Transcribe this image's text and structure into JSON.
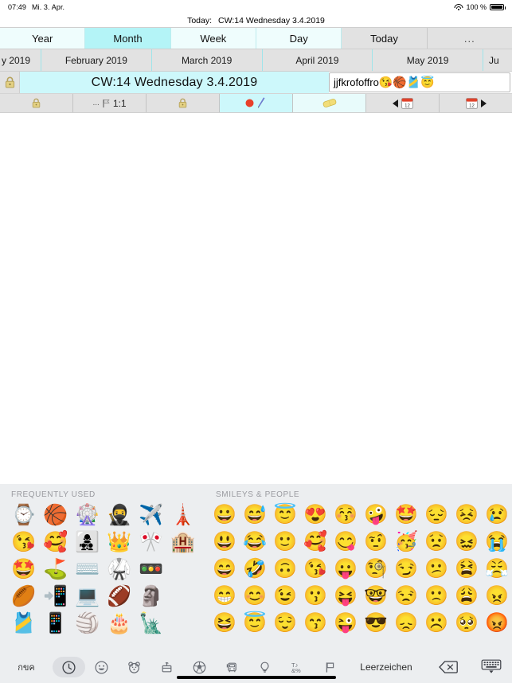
{
  "status_bar": {
    "time": "07:49",
    "date": "Mi. 3. Apr.",
    "wifi_icon": "wifi-icon",
    "battery_percent": "100 %",
    "battery_icon": "battery-full-icon"
  },
  "today_line": {
    "label": "Today:",
    "value": "CW:14 Wednesday 3.4.2019"
  },
  "view_tabs": [
    {
      "label": "Year",
      "selected": false,
      "style": "cyan"
    },
    {
      "label": "Month",
      "selected": true,
      "style": "cyan"
    },
    {
      "label": "Week",
      "selected": false,
      "style": "cyan"
    },
    {
      "label": "Day",
      "selected": false,
      "style": "cyan"
    },
    {
      "label": "Today",
      "selected": false,
      "style": "grey"
    },
    {
      "label": "...",
      "selected": false,
      "style": "grey"
    }
  ],
  "month_row": [
    {
      "label": "y 2019",
      "clipped": true
    },
    {
      "label": "February 2019",
      "clipped": false
    },
    {
      "label": "March 2019",
      "clipped": false
    },
    {
      "label": "April 2019",
      "clipped": false
    },
    {
      "label": "May 2019",
      "clipped": false
    },
    {
      "label": "Ju",
      "clipped": true
    }
  ],
  "cw_row": {
    "lock_icon": "lock-icon",
    "title": "CW:14 Wednesday 3.4.2019",
    "input_text": "jjfkrofoffro",
    "input_emojis": "😘🏀🎽😇"
  },
  "toolbar": [
    {
      "name": "lock-left",
      "icon": "🔒",
      "label": "",
      "state": "normal"
    },
    {
      "name": "zoom-ratio",
      "icon": "🏳",
      "label": "1:1",
      "prefix": "...",
      "state": "normal"
    },
    {
      "name": "lock-right",
      "icon": "🔒",
      "label": "",
      "state": "normal"
    },
    {
      "name": "record-pen",
      "icon": "🔴✒️",
      "label": "",
      "state": "highlighted"
    },
    {
      "name": "eraser",
      "icon": "🧽",
      "label": "",
      "state": "highlighted-light"
    },
    {
      "name": "prev-calendar",
      "icon": "◀📅",
      "label": "",
      "state": "normal"
    },
    {
      "name": "next-calendar",
      "icon": "📅▶",
      "label": "",
      "state": "normal"
    }
  ],
  "keyboard": {
    "sections": [
      {
        "title": "FREQUENTLY USED",
        "emojis": [
          "⌚",
          "😘",
          "🤩",
          "🏉",
          "🎽",
          "🏀",
          "🥰",
          "⛳",
          "📲",
          "📱",
          "🎡",
          "👩‍👧‍👦",
          "⌨️",
          "💻",
          "🏐",
          "🥷",
          "👑",
          "🥋",
          "🏈",
          "🎂",
          "✈️",
          "🎌",
          "🚥",
          "🗿",
          "🗽",
          "🗼",
          "🏨",
          "",
          "",
          ""
        ]
      },
      {
        "title": "SMILEYS & PEOPLE",
        "emojis": [
          "😀",
          "😃",
          "😄",
          "😁",
          "😆",
          "😅",
          "😂",
          "🤣",
          "😊",
          "😇",
          "😇",
          "🙂",
          "🙃",
          "😉",
          "😌",
          "😍",
          "🥰",
          "😘",
          "😗",
          "😙",
          "😚",
          "😋",
          "😛",
          "😝",
          "😜",
          "🤪",
          "🤨",
          "🧐",
          "🤓",
          "😎",
          "🤩",
          "🥳",
          "😏",
          "😒",
          "😞",
          "😔",
          "😟",
          "😕",
          "🙁",
          "☹️",
          "😣",
          "😖",
          "😫",
          "😩",
          "🥺",
          "😢",
          "😭",
          "😤",
          "😠",
          "😡"
        ]
      }
    ],
    "bottom_bar": {
      "globe_label": "กขค",
      "categories": [
        {
          "name": "recent-category",
          "icon": "clock-icon",
          "selected": true
        },
        {
          "name": "smileys-category",
          "icon": "smiley-icon",
          "selected": false
        },
        {
          "name": "animals-category",
          "icon": "bear-icon",
          "selected": false
        },
        {
          "name": "food-category",
          "icon": "food-icon",
          "selected": false
        },
        {
          "name": "activity-category",
          "icon": "soccer-icon",
          "selected": false
        },
        {
          "name": "travel-category",
          "icon": "car-icon",
          "selected": false
        },
        {
          "name": "objects-category",
          "icon": "bulb-icon",
          "selected": false
        },
        {
          "name": "symbols-category",
          "icon": "symbols-icon",
          "selected": false
        },
        {
          "name": "flags-category",
          "icon": "flag-icon",
          "selected": false
        }
      ],
      "space_label": "Leerzeichen",
      "delete_icon": "delete-backward-icon",
      "dismiss_icon": "keyboard-dismiss-icon"
    }
  },
  "colors": {
    "tab_selected": "#b4f4f7",
    "tab_cyan": "#effdfd",
    "tab_grey": "#e2e2e2",
    "cw_title_bg": "#cdf8fb",
    "keyboard_bg": "#eceef0"
  }
}
